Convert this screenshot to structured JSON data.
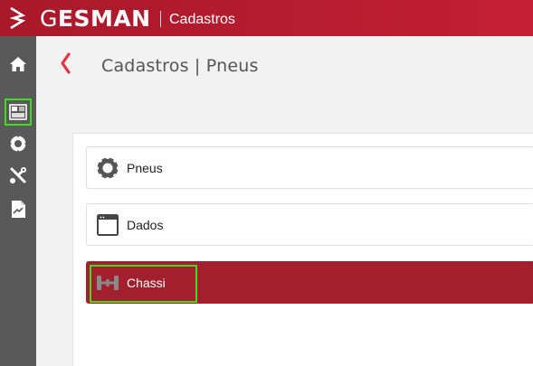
{
  "header": {
    "brand_initial": "G",
    "brand_rest": "ESMAN",
    "section": "Cadastros"
  },
  "sidebar": {
    "items": [
      {
        "name": "home-icon"
      },
      {
        "name": "dashboard-icon",
        "active": true
      },
      {
        "name": "tire-icon"
      },
      {
        "name": "tools-icon"
      },
      {
        "name": "report-icon"
      }
    ]
  },
  "page": {
    "title": "Cadastros | Pneus"
  },
  "list": {
    "items": [
      {
        "label": "Pneus",
        "icon": "tire-icon"
      },
      {
        "label": "Dados",
        "icon": "window-icon"
      },
      {
        "label": "Chassi",
        "icon": "axle-icon",
        "selected": true
      }
    ]
  },
  "colors": {
    "brand_red": "#b81c30",
    "selected_red": "#a21f2e",
    "sidebar_gray": "#595959",
    "highlight_green": "#3fdc1d"
  }
}
